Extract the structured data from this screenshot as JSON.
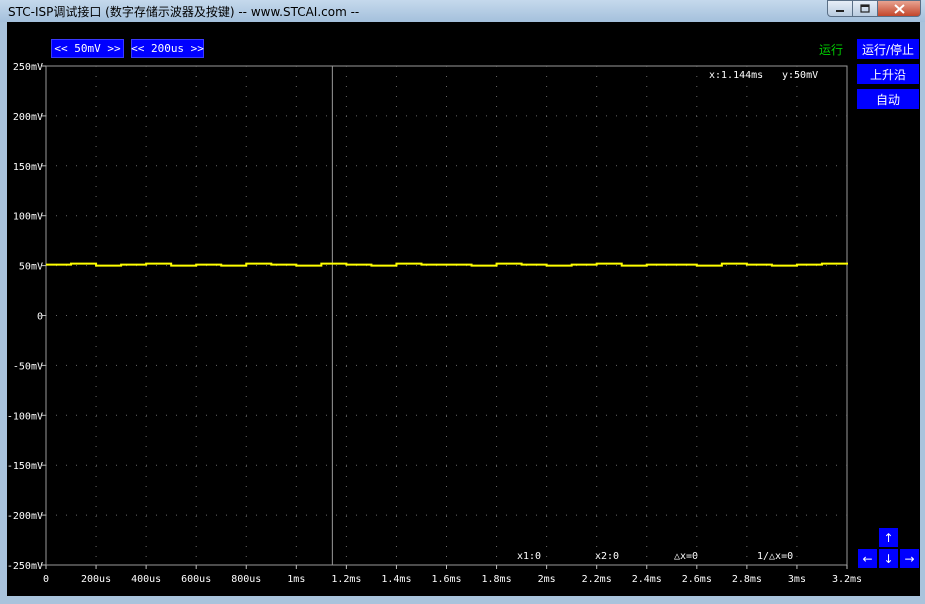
{
  "window": {
    "title": "STC-ISP调试接口 (数字存储示波器及按键) -- www.STCAI.com --",
    "minimize_icon": "minimize-icon",
    "maximize_icon": "maximize-icon",
    "close_icon": "close-icon"
  },
  "controls": {
    "volt_button": "<<  50mV  >>",
    "time_button": "<< 200us >>",
    "status": "运行",
    "run_stop": "运行/停止",
    "rising_edge": "上升沿",
    "auto": "自动",
    "arrow_up": "↑",
    "arrow_left": "←",
    "arrow_down": "↓",
    "arrow_right": "→"
  },
  "readout": {
    "x": "x:1.144ms",
    "y": "y:50mV",
    "x1": "x1:0",
    "x2": "x2:0",
    "dx": "△x=0",
    "inv_dx": "1/△x=0"
  },
  "colors": {
    "trace": "#ffff00",
    "button_bg": "#0000ff",
    "status_color": "#00cc00",
    "background": "#000000"
  },
  "chart_data": {
    "type": "line",
    "title": "",
    "xlabel": "",
    "ylabel": "",
    "x_unit_ticks": [
      "0",
      "200us",
      "400us",
      "600us",
      "800us",
      "1ms",
      "1.2ms",
      "1.4ms",
      "1.6ms",
      "1.8ms",
      "2ms",
      "2.2ms",
      "2.4ms",
      "2.6ms",
      "2.8ms",
      "3ms",
      "3.2ms"
    ],
    "y_unit_ticks": [
      "250mV",
      "200mV",
      "150mV",
      "100mV",
      "50mV",
      "0",
      "-50mV",
      "-100mV",
      "-150mV",
      "-200mV",
      "-250mV"
    ],
    "xlim_ms": [
      0,
      3.2
    ],
    "ylim_mV": [
      -250,
      250
    ],
    "grid": "dotted",
    "cursor_x_ms": 1.144,
    "series": [
      {
        "x_ms": [
          0,
          0.1,
          0.2,
          0.3,
          0.4,
          0.5,
          0.6,
          0.7,
          0.8,
          0.9,
          1.0,
          1.1,
          1.2,
          1.3,
          1.4,
          1.5,
          1.6,
          1.7,
          1.8,
          1.9,
          2.0,
          2.1,
          2.2,
          2.3,
          2.4,
          2.5,
          2.6,
          2.7,
          2.8,
          2.9,
          3.0,
          3.1,
          3.2
        ],
        "y_mV": [
          51,
          52,
          50,
          51,
          52,
          50,
          51,
          50,
          52,
          51,
          50,
          52,
          51,
          50,
          52,
          51,
          51,
          50,
          52,
          51,
          50,
          51,
          52,
          50,
          51,
          51,
          50,
          52,
          51,
          50,
          51,
          52,
          51
        ]
      }
    ]
  }
}
